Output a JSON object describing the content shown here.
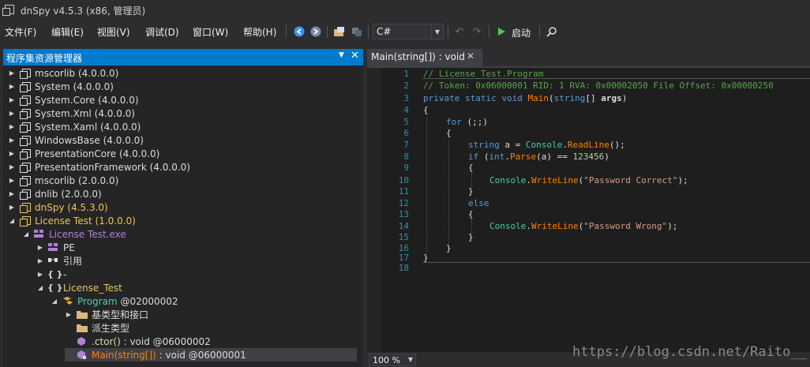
{
  "window": {
    "title": "dnSpy v4.5.3 (x86, 管理员)"
  },
  "menu": [
    "文件(F)",
    "编辑(E)",
    "视图(V)",
    "调试(D)",
    "窗口(W)",
    "帮助(H)"
  ],
  "toolbar": {
    "language": "C#",
    "run_label": "启动",
    "icons": [
      "back-icon",
      "forward-icon",
      "open-file-icon",
      "save-icon",
      "undo-icon",
      "redo-icon",
      "play-icon",
      "search-icon"
    ]
  },
  "explorer": {
    "title": "程序集资源管理器",
    "items": [
      {
        "name": "mscorlib",
        "version": "(4.0.0.0)"
      },
      {
        "name": "System",
        "version": "(4.0.0.0)"
      },
      {
        "name": "System.Core",
        "version": "(4.0.0.0)"
      },
      {
        "name": "System.Xml",
        "version": "(4.0.0.0)"
      },
      {
        "name": "System.Xaml",
        "version": "(4.0.0.0)"
      },
      {
        "name": "WindowsBase",
        "version": "(4.0.0.0)"
      },
      {
        "name": "PresentationCore",
        "version": "(4.0.0.0)"
      },
      {
        "name": "PresentationFramework",
        "version": "(4.0.0.0)"
      },
      {
        "name": "mscorlib",
        "version": "(2.0.0.0)"
      },
      {
        "name": "dnlib",
        "version": "(2.0.0.0)"
      },
      {
        "name": "dnSpy",
        "version": "(4.5.3.0)"
      },
      {
        "name": "License Test",
        "version": "(1.0.0.0)"
      },
      {
        "name": "License Test.exe",
        "version": ""
      },
      {
        "name": "PE",
        "version": ""
      },
      {
        "name": "引用",
        "version": ""
      },
      {
        "name": "-",
        "version": ""
      },
      {
        "name": "License_Test",
        "version": ""
      },
      {
        "name": "Program",
        "version": "@02000002"
      },
      {
        "name": "基类型和接口",
        "version": ""
      },
      {
        "name": "派生类型",
        "version": ""
      },
      {
        "name": ".ctor()",
        "version": ": void @06000002"
      },
      {
        "name": "Main(string[])",
        "version": ": void @06000001"
      }
    ]
  },
  "editor": {
    "tab_title": "Main(string[]) : void",
    "line_numbers": [
      "1",
      "2",
      "3",
      "4",
      "5",
      "6",
      "7",
      "8",
      "9",
      "10",
      "11",
      "12",
      "13",
      "14",
      "15",
      "16",
      "17",
      "18"
    ],
    "lines": [
      "// License_Test.Program",
      "// Token: 0x06000001 RID: 1 RVA: 0x00002050 File Offset: 0x00000250",
      "private static void Main(string[] args)",
      "{",
      "for (;;)",
      "{",
      "string a = Console.ReadLine();",
      "if (int.Parse(a) == 123456)",
      "{",
      "Console.WriteLine(\"Password Correct\");",
      "}",
      "else",
      "{",
      "Console.WriteLine(\"Password Wrong\");",
      "}",
      "}",
      "}",
      ""
    ],
    "zoom": "100 %"
  },
  "watermark": "https://blog.csdn.net/Raito__"
}
